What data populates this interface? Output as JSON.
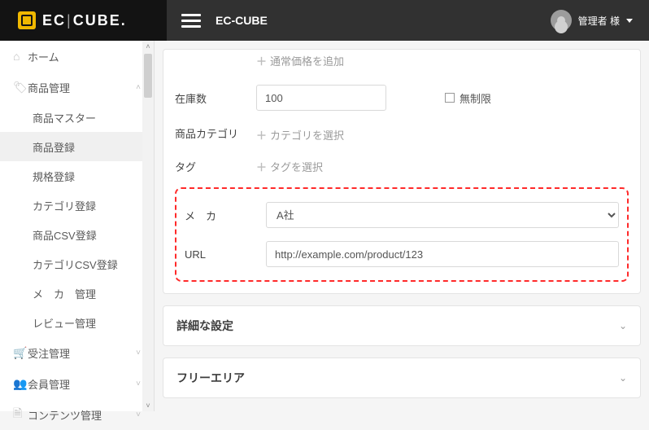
{
  "header": {
    "brand_left": "EC",
    "brand_right": "CUBE",
    "title": "EC-CUBE",
    "user_label": "管理者 様"
  },
  "sidebar": {
    "home": "ホーム",
    "product_mgmt": "商品管理",
    "sub": {
      "master": "商品マスター",
      "register": "商品登録",
      "spec": "規格登録",
      "category": "カテゴリ登録",
      "product_csv": "商品CSV登録",
      "category_csv": "カテゴリCSV登録",
      "maker": "メ　カ　管理",
      "review": "レビュー管理"
    },
    "order_mgmt": "受注管理",
    "member_mgmt": "会員管理",
    "content_mgmt": "コンテンツ管理"
  },
  "form": {
    "add_normal_price": "通常価格を追加",
    "stock_label": "在庫数",
    "stock_value": "100",
    "stock_unlimited": "無制限",
    "category_label": "商品カテゴリ",
    "category_select": "カテゴリを選択",
    "tag_label": "タグ",
    "tag_select": "タグを選択",
    "maker_label": "メ　カ",
    "maker_value": "A社",
    "url_label": "URL",
    "url_value": "http://example.com/product/123"
  },
  "accordions": {
    "detail": "詳細な設定",
    "freearea": "フリーエリア"
  }
}
